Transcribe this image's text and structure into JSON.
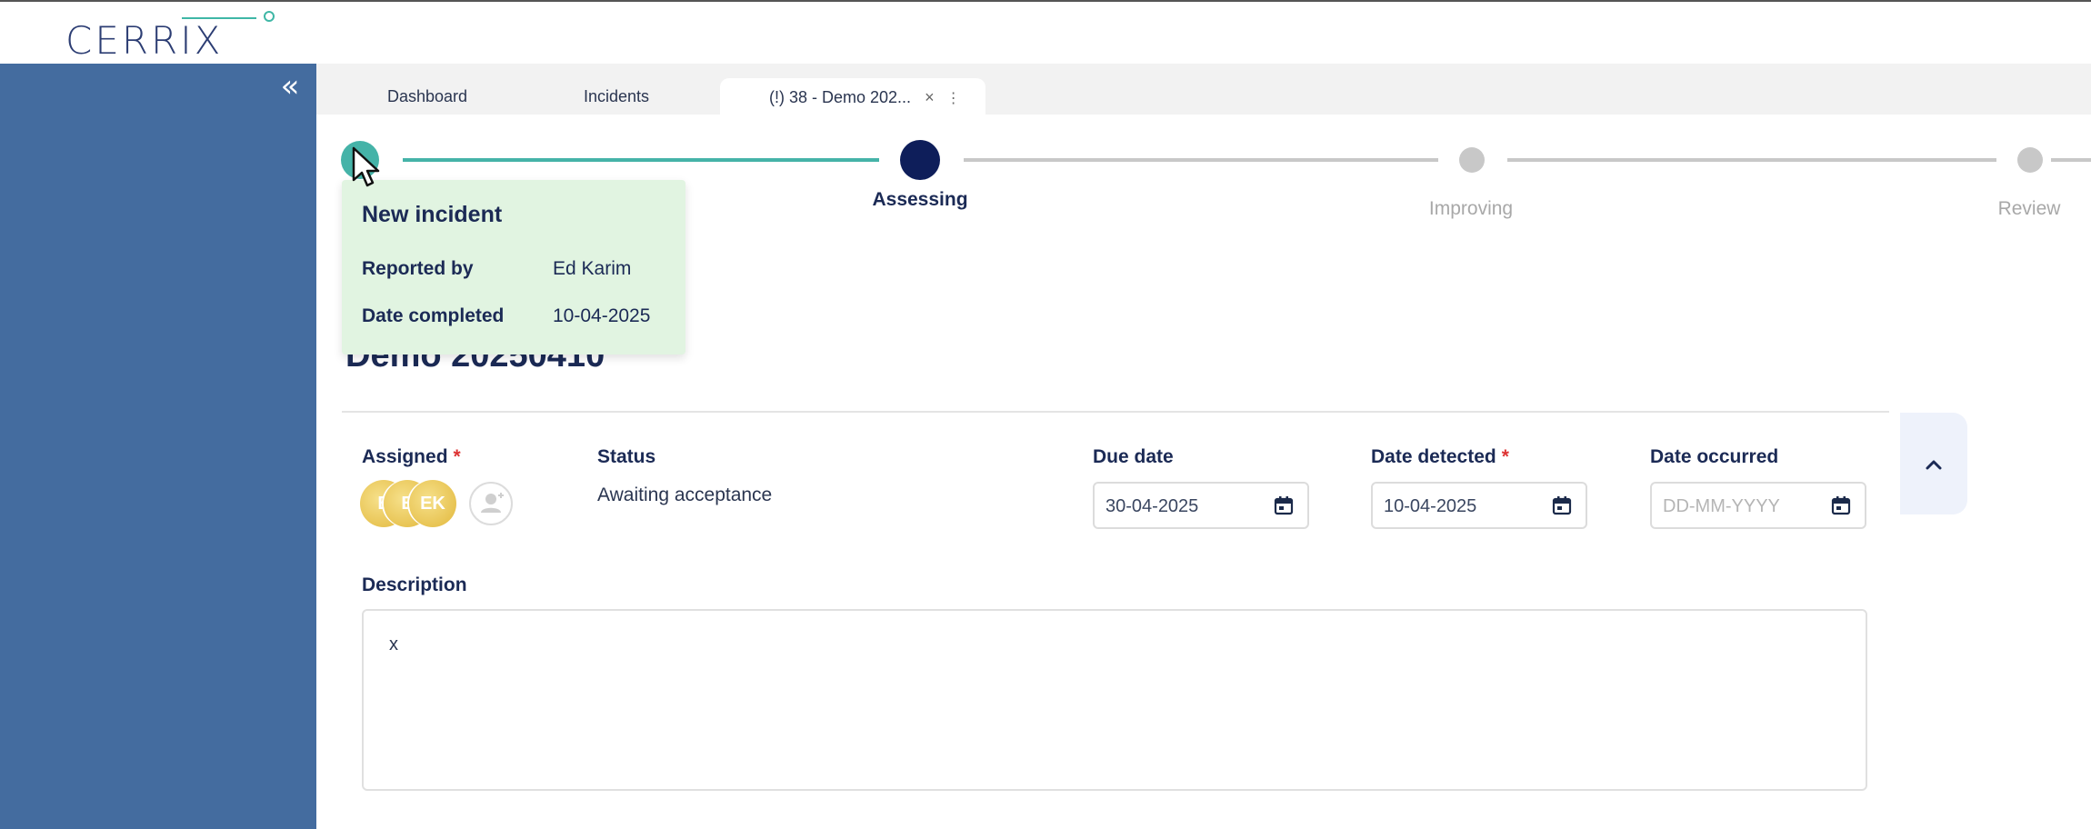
{
  "app": {
    "logo_text": "CERRIX"
  },
  "sidebar": {
    "collapse_glyph": "«"
  },
  "tabs": [
    {
      "label": "Dashboard"
    },
    {
      "label": "Incidents"
    },
    {
      "label": "(!) 38 - Demo 202...",
      "close_glyph": "×",
      "more_glyph": "⋮"
    }
  ],
  "stepper": {
    "steps": [
      {
        "label": "New incident",
        "state": "completed"
      },
      {
        "label": "Assessing",
        "state": "current"
      },
      {
        "label": "Improving",
        "state": "pending"
      },
      {
        "label": "Review",
        "state": "pending"
      }
    ],
    "colors": {
      "completed": "#45b3a8",
      "current": "#0e1e5a",
      "pending": "#c8c8c8"
    }
  },
  "tooltip": {
    "title": "New incident",
    "reported_by_label": "Reported by",
    "reported_by_value": "Ed Karim",
    "date_completed_label": "Date completed",
    "date_completed_value": "10-04-2025"
  },
  "incident": {
    "title": "Demo 20250410",
    "required_mark": "*"
  },
  "fields": {
    "assigned": {
      "label": "Assigned",
      "required": "*",
      "avatars": [
        "E",
        "E",
        "EK"
      ]
    },
    "status": {
      "label": "Status",
      "value": "Awaiting acceptance"
    },
    "due_date": {
      "label": "Due date",
      "value": "30-04-2025"
    },
    "date_detected": {
      "label": "Date detected",
      "required": "*",
      "value": "10-04-2025"
    },
    "date_occurred": {
      "label": "Date occurred",
      "placeholder": "DD-MM-YYYY"
    },
    "description": {
      "label": "Description",
      "value": "x"
    }
  },
  "icons": {
    "collapse": "chevron-double-left-icon",
    "calendar": "calendar-icon",
    "add_user": "add-user-icon",
    "chevron_up": "chevron-up-icon"
  }
}
